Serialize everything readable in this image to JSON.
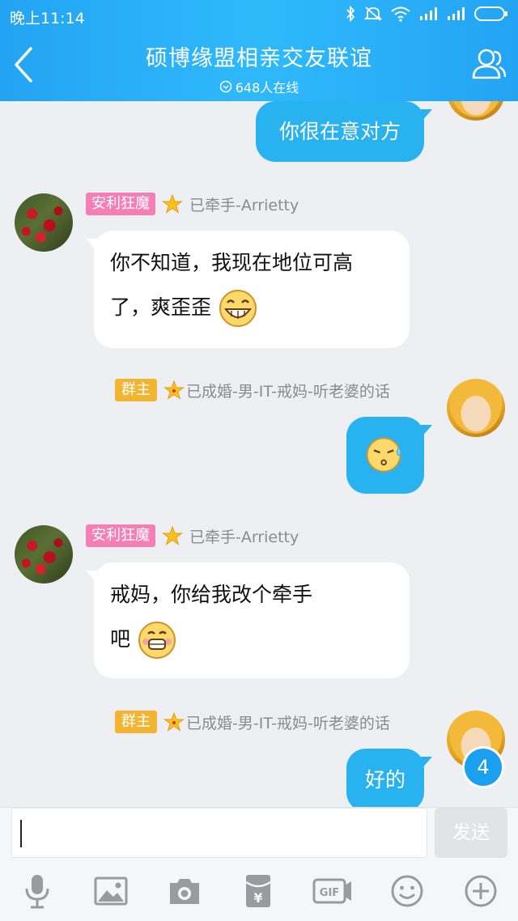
{
  "status": {
    "time": "晚上11:14"
  },
  "header": {
    "title": "硕博缘盟相亲交友联谊",
    "online": "648人在线"
  },
  "messages": [
    {
      "side": "right",
      "text": "你很在意对方"
    },
    {
      "side": "left",
      "role_badge": "安利狂魔",
      "nick": "已牵手-Arrietty",
      "line1": "你不知道，我现在地位可高",
      "line2": "了，爽歪歪"
    },
    {
      "side": "right",
      "role_badge": "群主",
      "nick": "已成婚-男-IT-戒妈-听老婆的话"
    },
    {
      "side": "left",
      "role_badge": "安利狂魔",
      "nick": "已牵手-Arrietty",
      "line1": "戒妈，你给我改个牵手",
      "line2": "吧"
    },
    {
      "side": "right",
      "role_badge": "群主",
      "nick": "已成婚-男-IT-戒妈-听老婆的话",
      "text": "好的"
    }
  ],
  "unread_count": "4",
  "composer": {
    "send_label": "发送"
  },
  "toolbar": [
    "mic-icon",
    "image-icon",
    "camera-icon",
    "red-packet-icon",
    "gif-icon",
    "emoji-icon",
    "plus-icon"
  ],
  "colors": {
    "header": "#2fb9fb",
    "bubble_self": "#29b2f0",
    "badge_owner": "#f2b532",
    "badge_member": "#f47fb7"
  }
}
